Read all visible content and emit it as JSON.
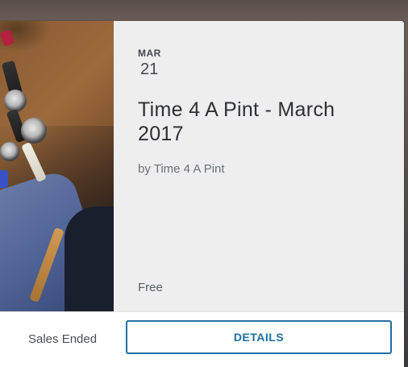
{
  "event": {
    "date_month": "MAR",
    "date_day": "21",
    "title": "Time 4 A Pint - March 2017",
    "organizer": "by Time 4 A Pint",
    "price": "Free"
  },
  "footer": {
    "sales_status": "Sales Ended",
    "details_label": "DETAILS"
  },
  "colors": {
    "accent": "#1f6f9f",
    "info_background": "#eeeeef",
    "title_text": "#2e3036"
  }
}
